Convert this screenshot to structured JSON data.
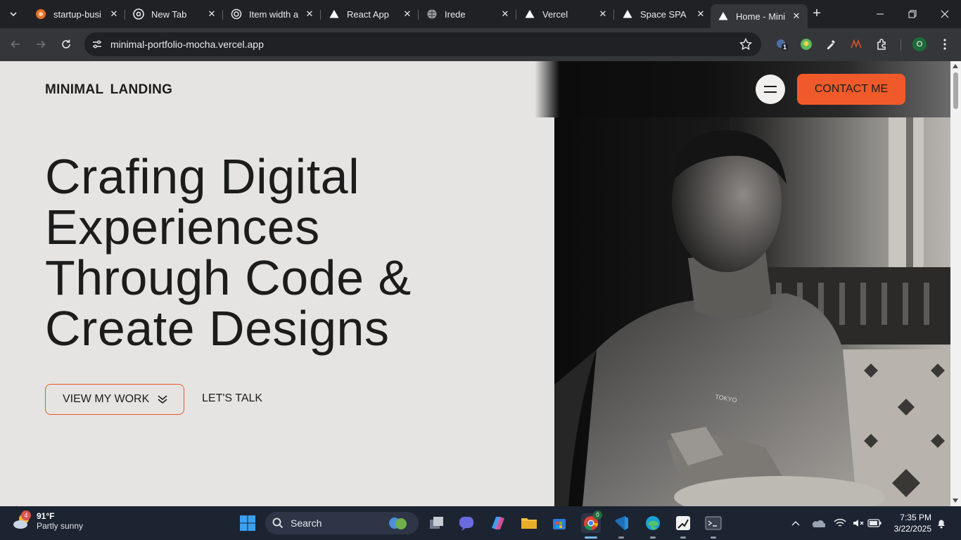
{
  "browser": {
    "tabs": [
      {
        "title": "startup-busi",
        "icon": "orange-logo-icon"
      },
      {
        "title": "New Tab",
        "icon": "chrome-icon"
      },
      {
        "title": "Item width a",
        "icon": "openai-icon"
      },
      {
        "title": "React App",
        "icon": "vercel-triangle-icon"
      },
      {
        "title": "Irede",
        "icon": "globe-icon"
      },
      {
        "title": "Vercel",
        "icon": "vercel-triangle-icon"
      },
      {
        "title": "Space SPA",
        "icon": "vercel-triangle-icon"
      },
      {
        "title": "Home - Mini",
        "icon": "vercel-triangle-icon",
        "active": true
      }
    ],
    "url": "minimal-portfolio-mocha.vercel.app",
    "profile_initial": "O",
    "extension_badge": "1"
  },
  "page": {
    "logo": "MINIMAL LANDING",
    "hero_title_lines": [
      "Crafing Digital",
      "Experiences",
      "Through Code &",
      "Create Designs"
    ],
    "primary_cta": "VIEW MY WORK",
    "secondary_cta": "LET'S TALK",
    "contact_button": "CONTACT ME",
    "shirt_text": "TOKYO",
    "colors": {
      "accent": "#f05a2a",
      "background": "#e6e4e2",
      "text": "#1c1c1c"
    }
  },
  "taskbar": {
    "weather_badge": "4",
    "temperature": "91°F",
    "condition": "Partly sunny",
    "search_label": "Search",
    "chrome_badge": "0",
    "time": "7:35 PM",
    "date": "3/22/2025"
  }
}
